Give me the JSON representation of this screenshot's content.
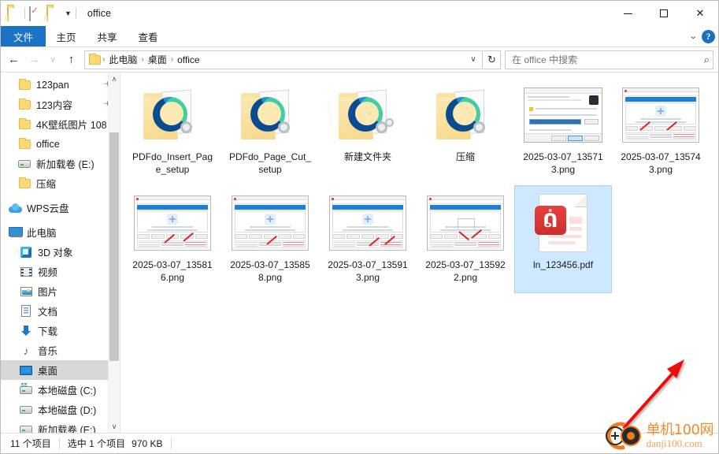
{
  "window": {
    "title": "office",
    "quick_access": [
      {
        "name": "folder-icon",
        "label": "文件夹"
      },
      {
        "name": "properties-icon",
        "label": "属性"
      },
      {
        "name": "new-folder-icon",
        "label": "新建文件夹"
      },
      {
        "name": "customize-caret-icon",
        "label": "自定义快速访问工具栏"
      }
    ],
    "controls": {
      "minimize": "最小化",
      "maximize": "最大化",
      "close": "关闭"
    }
  },
  "ribbon": {
    "tabs": [
      {
        "label": "文件",
        "active": true
      },
      {
        "label": "主页",
        "active": false
      },
      {
        "label": "共享",
        "active": false
      },
      {
        "label": "查看",
        "active": false
      }
    ],
    "collapse_label": "展开功能区",
    "help_label": "?"
  },
  "address": {
    "back_label": "←",
    "forward_label": "→",
    "recent_label": "∨",
    "up_label": "↑",
    "breadcrumbs": [
      "此电脑",
      "桌面",
      "office"
    ],
    "separator": "›",
    "dropdown_label": "∨",
    "refresh_label": "↻"
  },
  "search": {
    "placeholder": "在 office 中搜索",
    "icon": "search-icon"
  },
  "sidebar": {
    "items": [
      {
        "label": "123pan",
        "icon": "folder-icon",
        "pinned": true,
        "indent": 1,
        "selected": false
      },
      {
        "label": "123内容",
        "icon": "folder-icon",
        "pinned": true,
        "indent": 1,
        "selected": false
      },
      {
        "label": "4K壁纸图片 108",
        "icon": "folder-icon",
        "pinned": false,
        "indent": 1,
        "selected": false
      },
      {
        "label": "office",
        "icon": "folder-icon",
        "pinned": false,
        "indent": 1,
        "selected": false
      },
      {
        "label": "新加载卷 (E:)",
        "icon": "drive-icon",
        "pinned": false,
        "indent": 1,
        "selected": false
      },
      {
        "label": "压缩",
        "icon": "folder-icon",
        "pinned": false,
        "indent": 1,
        "selected": false
      },
      {
        "label": "WPS云盘",
        "icon": "cloud-icon",
        "pinned": false,
        "indent": 0,
        "selected": false
      },
      {
        "label": "此电脑",
        "icon": "pc-icon",
        "pinned": false,
        "indent": 0,
        "selected": false
      },
      {
        "label": "3D 对象",
        "icon": "3d-objects-icon",
        "pinned": false,
        "indent": 1,
        "selected": false
      },
      {
        "label": "视频",
        "icon": "videos-icon",
        "pinned": false,
        "indent": 1,
        "selected": false
      },
      {
        "label": "图片",
        "icon": "pictures-icon",
        "pinned": false,
        "indent": 1,
        "selected": false
      },
      {
        "label": "文档",
        "icon": "documents-icon",
        "pinned": false,
        "indent": 1,
        "selected": false
      },
      {
        "label": "下载",
        "icon": "downloads-icon",
        "pinned": false,
        "indent": 1,
        "selected": false
      },
      {
        "label": "音乐",
        "icon": "music-icon",
        "pinned": false,
        "indent": 1,
        "selected": false
      },
      {
        "label": "桌面",
        "icon": "desktop-icon",
        "pinned": false,
        "indent": 1,
        "selected": true
      },
      {
        "label": "本地磁盘 (C:)",
        "icon": "system-drive-icon",
        "pinned": false,
        "indent": 1,
        "selected": false
      },
      {
        "label": "本地磁盘 (D:)",
        "icon": "drive-icon",
        "pinned": false,
        "indent": 1,
        "selected": false
      },
      {
        "label": "新加载卷 (E:)",
        "icon": "drive-icon",
        "pinned": false,
        "indent": 1,
        "selected": false
      }
    ],
    "scroll_up_label": "∧",
    "scroll_down_label": "∨"
  },
  "files": [
    {
      "name": "PDFdo_Insert_Page_setup",
      "kind": "edge-folder",
      "selected": false
    },
    {
      "name": "PDFdo_Page_Cut_setup",
      "kind": "edge-folder",
      "selected": false
    },
    {
      "name": "新建文件夹",
      "kind": "gear-folder",
      "selected": false
    },
    {
      "name": "压缩",
      "kind": "edge-folder",
      "selected": false
    },
    {
      "name": "2025-03-07_135713.png",
      "kind": "installer-thumb",
      "selected": false
    },
    {
      "name": "2025-03-07_135743.png",
      "kind": "app-thumb",
      "selected": false
    },
    {
      "name": "2025-03-07_135816.png",
      "kind": "app-thumb",
      "selected": false
    },
    {
      "name": "2025-03-07_135858.png",
      "kind": "app-thumb",
      "selected": false
    },
    {
      "name": "2025-03-07_135913.png",
      "kind": "app-thumb",
      "selected": false
    },
    {
      "name": "2025-03-07_135922.png",
      "kind": "app-thumb",
      "selected": false
    },
    {
      "name": "ln_123456.pdf",
      "kind": "pdf",
      "selected": true
    }
  ],
  "status": {
    "item_count": "11 个项目",
    "selection": "选中 1 个项目",
    "size": "970 KB"
  },
  "annotation": {
    "arrow_color": "#ee1111",
    "points_to": "ln_123456.pdf"
  },
  "watermark": {
    "cn": "单机100网",
    "en": "danji100.com",
    "color": "#f28b30"
  },
  "colors": {
    "accent": "#1c72c4",
    "selection": "#cde8ff",
    "tree_selection": "#d8d8d8",
    "folder": "#fcd975"
  }
}
